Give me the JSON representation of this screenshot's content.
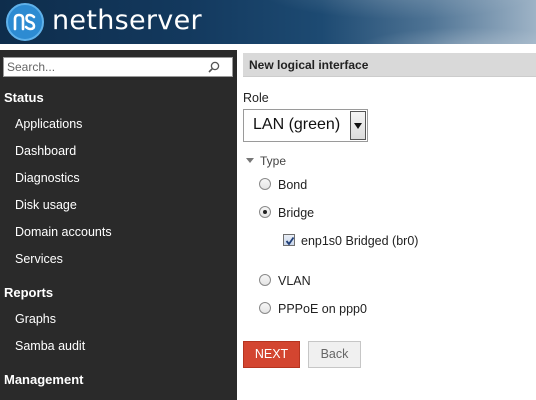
{
  "header": {
    "brand": "nethserver",
    "logo_icon": "nethserver-logo-icon"
  },
  "sidebar": {
    "search": {
      "placeholder": "Search...",
      "value": ""
    },
    "sections": [
      {
        "title": "Status",
        "items": [
          "Applications",
          "Dashboard",
          "Diagnostics",
          "Disk usage",
          "Domain accounts",
          "Services"
        ]
      },
      {
        "title": "Reports",
        "items": [
          "Graphs",
          "Samba audit"
        ]
      },
      {
        "title": "Management",
        "items": []
      }
    ]
  },
  "main": {
    "panel_title": "New logical interface",
    "role": {
      "label": "Role",
      "selected": "LAN (green)"
    },
    "type": {
      "legend": "Type",
      "options": [
        {
          "label": "Bond",
          "checked": false
        },
        {
          "label": "Bridge",
          "checked": true
        },
        {
          "label": "VLAN",
          "checked": false
        },
        {
          "label": "PPPoE on ppp0",
          "checked": false
        }
      ],
      "bridge_members": [
        {
          "label": "enp1s0 Bridged (br0)",
          "checked": true
        }
      ]
    },
    "buttons": {
      "next": "NEXT",
      "back": "Back"
    }
  },
  "colors": {
    "sidebar_bg": "#2a2a2a",
    "next_button": "#d34530",
    "panel_title_bg": "#d9d9d9",
    "logo_blue": "#2d8bd2"
  }
}
